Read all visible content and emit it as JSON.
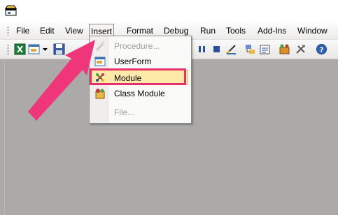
{
  "menubar": {
    "items": [
      {
        "label": "File",
        "mnemonic": "F"
      },
      {
        "label": "Edit",
        "mnemonic": "E"
      },
      {
        "label": "View",
        "mnemonic": "V"
      },
      {
        "label": "Insert",
        "mnemonic": "I"
      },
      {
        "label": "Format",
        "mnemonic": "o"
      },
      {
        "label": "Debug",
        "mnemonic": "D"
      },
      {
        "label": "Run",
        "mnemonic": "R"
      },
      {
        "label": "Tools",
        "mnemonic": "T"
      },
      {
        "label": "Add-Ins",
        "mnemonic": "A"
      },
      {
        "label": "Window",
        "mnemonic": "W"
      }
    ],
    "active": "Insert"
  },
  "insert_menu": {
    "items": [
      {
        "label": "Procedure...",
        "enabled": false,
        "icon": "procedure-icon"
      },
      {
        "label": "UserForm",
        "enabled": true,
        "icon": "userform-icon"
      },
      {
        "label": "Module",
        "enabled": true,
        "icon": "module-icon",
        "highlighted": true
      },
      {
        "label": "Class Module",
        "enabled": true,
        "icon": "class-module-icon"
      },
      {
        "label": "File...",
        "enabled": false,
        "icon": "none"
      }
    ]
  },
  "colors": {
    "annotation": "#e8306c",
    "highlight_fill": "#ffe9a8",
    "workspace": "#abaaa9"
  }
}
